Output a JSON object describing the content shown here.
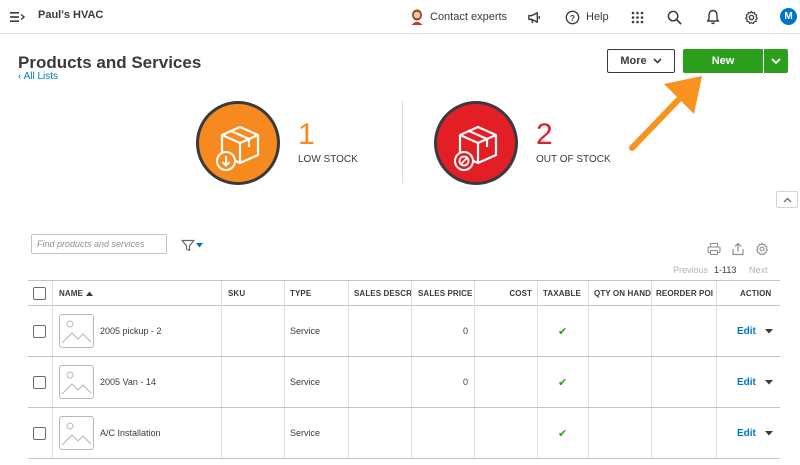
{
  "topbar": {
    "company": "Paul's HVAC",
    "contact_label": "Contact experts",
    "help_label": "Help",
    "avatar_initial": "M"
  },
  "header": {
    "title": "Products and Services",
    "all_lists": "All Lists",
    "more_label": "More",
    "new_label": "New"
  },
  "stock": {
    "low": {
      "count": "1",
      "label": "LOW STOCK",
      "color": "#f68a1e"
    },
    "out": {
      "count": "2",
      "label": "OUT OF STOCK",
      "color": "#e41e25"
    }
  },
  "filter": {
    "search_placeholder": "Find products and services"
  },
  "pagination": {
    "previous": "Previous",
    "range": "1-113",
    "next": "Next"
  },
  "table": {
    "headers": {
      "name": "NAME",
      "sku": "SKU",
      "type": "TYPE",
      "sales_desc": "SALES DESCRI",
      "sales_price": "SALES PRICE",
      "cost": "COST",
      "taxable": "TAXABLE",
      "qty": "QTY ON HAND",
      "reorder": "REORDER POI",
      "action": "ACTION"
    },
    "rows": [
      {
        "name": "2005 pickup - 2",
        "type": "Service",
        "sales_price": "0",
        "taxable": "✔",
        "action": "Edit"
      },
      {
        "name": "2005 Van - 14",
        "type": "Service",
        "sales_price": "0",
        "taxable": "✔",
        "action": "Edit"
      },
      {
        "name": "A/C Installation",
        "type": "Service",
        "sales_price": "",
        "taxable": "✔",
        "action": "Edit"
      }
    ]
  },
  "colors": {
    "brand_green": "#2ca01c",
    "link_blue": "#0077c5",
    "annotation_arrow": "#f7931e"
  }
}
